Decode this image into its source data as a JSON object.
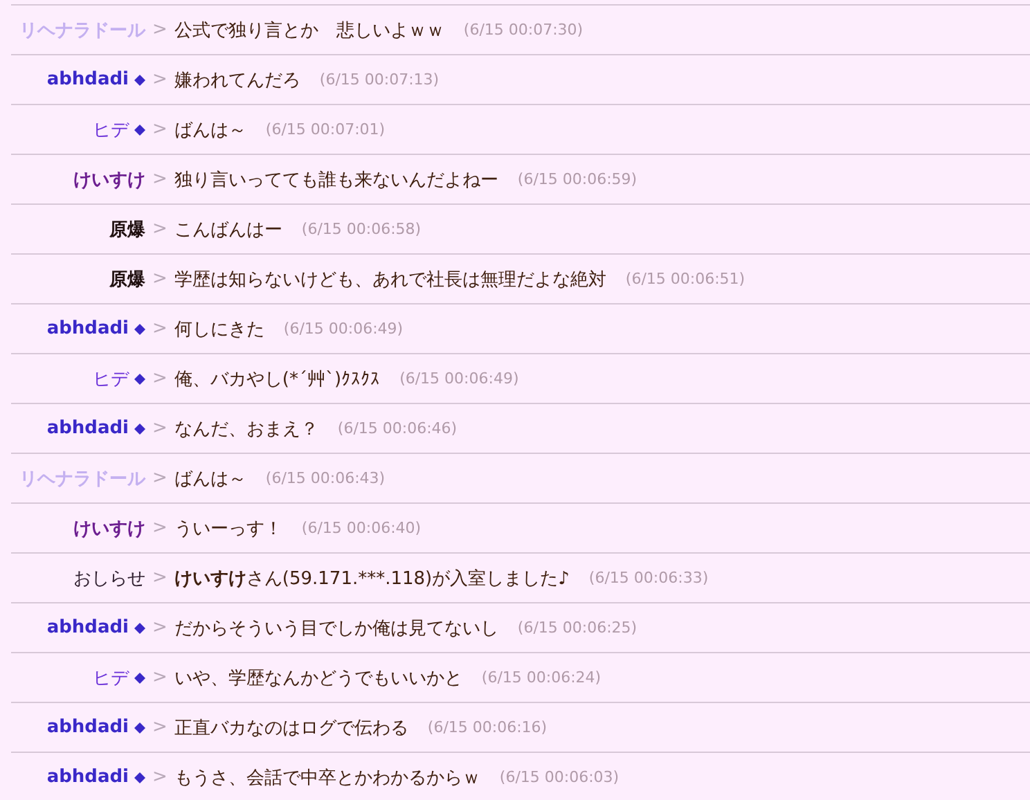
{
  "messages": [
    {
      "name": "リヘナラドール",
      "color": "#c4b0f0",
      "bold": true,
      "diamond": false,
      "text": "公式で独り言とか　悲しいよｗｗ",
      "time": "(6/15 00:07:30)"
    },
    {
      "name": "abhdadi",
      "color": "#3a28c8",
      "bold": true,
      "diamond": true,
      "text": "嫌われてんだろ",
      "time": "(6/15 00:07:13)"
    },
    {
      "name": "ヒデ",
      "color": "#6a30d8",
      "bold": false,
      "diamond": true,
      "text": "ばんは～",
      "time": "(6/15 00:07:01)"
    },
    {
      "name": "けいすけ",
      "color": "#6c1e90",
      "bold": true,
      "diamond": false,
      "text": "独り言いってても誰も来ないんだよねー",
      "time": "(6/15 00:06:59)"
    },
    {
      "name": "原爆",
      "color": "#201010",
      "bold": true,
      "diamond": false,
      "text": "こんばんはー",
      "time": "(6/15 00:06:58)"
    },
    {
      "name": "原爆",
      "color": "#201010",
      "bold": true,
      "diamond": false,
      "text": "学歴は知らないけども、あれで社長は無理だよな絶対",
      "time": "(6/15 00:06:51)"
    },
    {
      "name": "abhdadi",
      "color": "#3a28c8",
      "bold": true,
      "diamond": true,
      "text": "何しにきた",
      "time": "(6/15 00:06:49)"
    },
    {
      "name": "ヒデ",
      "color": "#6a30d8",
      "bold": false,
      "diamond": true,
      "text": "俺、バカやし(*´艸`)ｸｽｸｽ",
      "time": "(6/15 00:06:49)"
    },
    {
      "name": "abhdadi",
      "color": "#3a28c8",
      "bold": true,
      "diamond": true,
      "text": "なんだ、おまえ？",
      "time": "(6/15 00:06:46)"
    },
    {
      "name": "リヘナラドール",
      "color": "#c4b0f0",
      "bold": true,
      "diamond": false,
      "text": "ばんは～",
      "time": "(6/15 00:06:43)"
    },
    {
      "name": "けいすけ",
      "color": "#6c1e90",
      "bold": true,
      "diamond": false,
      "text": "ういーっす！",
      "time": "(6/15 00:06:40)"
    },
    {
      "name": "おしらせ",
      "color": "#302030",
      "bold": false,
      "diamond": false,
      "text": "**けいすけ**さん(59.171.***.118)が入室しました♪",
      "time": "(6/15 00:06:33)"
    },
    {
      "name": "abhdadi",
      "color": "#3a28c8",
      "bold": true,
      "diamond": true,
      "text": "だからそういう目でしか俺は見てないし",
      "time": "(6/15 00:06:25)"
    },
    {
      "name": "ヒデ",
      "color": "#6a30d8",
      "bold": false,
      "diamond": true,
      "text": "いや、学歴なんかどうでもいいかと",
      "time": "(6/15 00:06:24)"
    },
    {
      "name": "abhdadi",
      "color": "#3a28c8",
      "bold": true,
      "diamond": true,
      "text": "正直バカなのはログで伝わる",
      "time": "(6/15 00:06:16)"
    },
    {
      "name": "abhdadi",
      "color": "#3a28c8",
      "bold": true,
      "diamond": true,
      "text": "もうさ、会話で中卒とかわかるからｗ",
      "time": "(6/15 00:06:03)"
    }
  ],
  "separator": ">"
}
